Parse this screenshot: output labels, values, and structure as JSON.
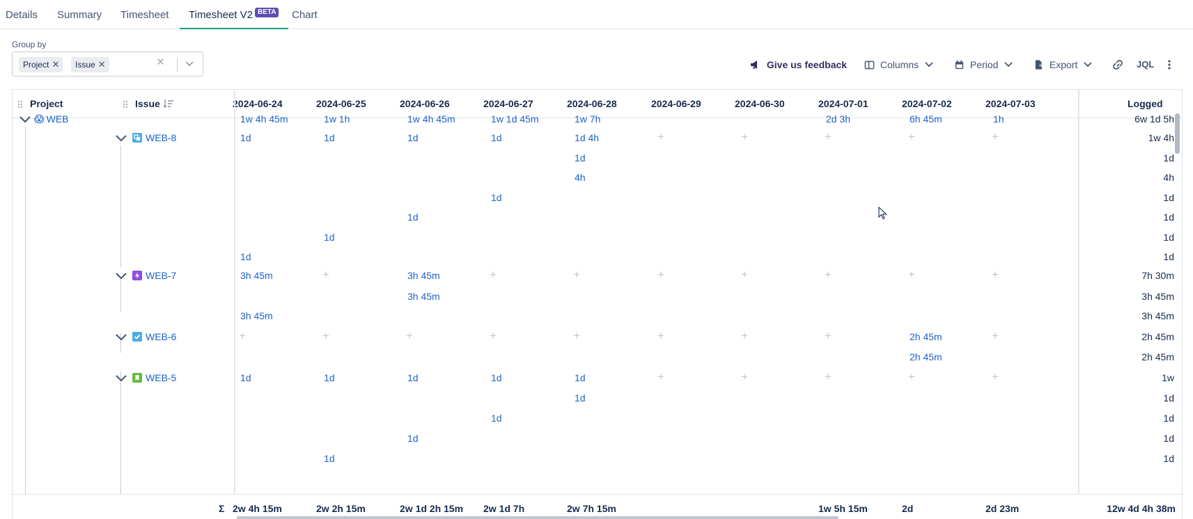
{
  "tabs": [
    {
      "label": "Details"
    },
    {
      "label": "Summary"
    },
    {
      "label": "Timesheet"
    },
    {
      "label": "Timesheet V2",
      "badge": "BETA",
      "active": true
    },
    {
      "label": "Chart"
    }
  ],
  "group_by": {
    "label": "Group by",
    "chips": [
      "Project",
      "Issue"
    ],
    "clear_glyph": "×"
  },
  "toolbar": {
    "feedback": "Give us feedback",
    "columns": "Columns",
    "period": "Period",
    "export": "Export",
    "jql": "JQL"
  },
  "grid": {
    "col_project": "Project",
    "col_issue": "Issue",
    "dates": [
      "2024-06-24",
      "2024-06-25",
      "2024-06-26",
      "2024-06-27",
      "2024-06-28",
      "2024-06-29",
      "2024-06-30",
      "2024-07-01",
      "2024-07-02",
      "2024-07-03"
    ],
    "col_logged": "Logged",
    "project": {
      "key": "WEB",
      "emoji": "😱"
    },
    "rows": [
      {
        "type": "project",
        "label": "WEB",
        "cells": [
          "1w 4h 45m",
          "1w 1h",
          "1w 4h 45m",
          "1w 1d 45m",
          "1w 7h",
          "",
          "",
          "2d 3h",
          "6h 45m",
          "1h"
        ],
        "logged": "6w 1d 5h"
      },
      {
        "type": "issue",
        "label": "WEB-8",
        "icon": "subtask-icon",
        "color": "#4bade8",
        "cells": [
          "1d",
          "1d",
          "1d",
          "1d",
          "1d 4h",
          "+",
          "+",
          "+",
          "+",
          "+"
        ],
        "logged": "1w 4h"
      },
      {
        "type": "entry",
        "cells": [
          "",
          "",
          "",
          "",
          "1d",
          "",
          "",
          "",
          "",
          ""
        ],
        "logged": "1d"
      },
      {
        "type": "entry",
        "cells": [
          "",
          "",
          "",
          "",
          "4h",
          "",
          "",
          "",
          "",
          ""
        ],
        "logged": "4h"
      },
      {
        "type": "entry",
        "cells": [
          "",
          "",
          "",
          "1d",
          "",
          "",
          "",
          "",
          "",
          ""
        ],
        "logged": "1d"
      },
      {
        "type": "entry",
        "cells": [
          "",
          "",
          "1d",
          "",
          "",
          "",
          "",
          "",
          "",
          ""
        ],
        "logged": "1d"
      },
      {
        "type": "entry",
        "cells": [
          "",
          "1d",
          "",
          "",
          "",
          "",
          "",
          "",
          "",
          ""
        ],
        "logged": "1d"
      },
      {
        "type": "entry",
        "cells": [
          "1d",
          "",
          "",
          "",
          "",
          "",
          "",
          "",
          "",
          ""
        ],
        "logged": "1d"
      },
      {
        "type": "issue",
        "label": "WEB-7",
        "icon": "epic-icon",
        "color": "#904ee2",
        "cells": [
          "3h 45m",
          "+",
          "3h 45m",
          "+",
          "+",
          "+",
          "+",
          "+",
          "+",
          "+"
        ],
        "logged": "7h 30m"
      },
      {
        "type": "entry",
        "cells": [
          "",
          "",
          "3h 45m",
          "",
          "",
          "",
          "",
          "",
          "",
          ""
        ],
        "logged": "3h 45m"
      },
      {
        "type": "entry",
        "cells": [
          "3h 45m",
          "",
          "",
          "",
          "",
          "",
          "",
          "",
          "",
          ""
        ],
        "logged": "3h 45m"
      },
      {
        "type": "issue",
        "label": "WEB-6",
        "icon": "task-icon",
        "color": "#4bade8",
        "cells": [
          "+",
          "+",
          "+",
          "+",
          "+",
          "+",
          "+",
          "+",
          "2h 45m",
          "+"
        ],
        "logged": "2h 45m"
      },
      {
        "type": "entry",
        "cells": [
          "",
          "",
          "",
          "",
          "",
          "",
          "",
          "",
          "2h 45m",
          ""
        ],
        "logged": "2h 45m"
      },
      {
        "type": "issue",
        "label": "WEB-5",
        "icon": "story-icon",
        "color": "#63ba3c",
        "cells": [
          "1d",
          "1d",
          "1d",
          "1d",
          "1d",
          "+",
          "+",
          "+",
          "+",
          "+"
        ],
        "logged": "1w"
      },
      {
        "type": "entry",
        "cells": [
          "",
          "",
          "",
          "",
          "1d",
          "",
          "",
          "",
          "",
          ""
        ],
        "logged": "1d"
      },
      {
        "type": "entry",
        "cells": [
          "",
          "",
          "",
          "1d",
          "",
          "",
          "",
          "",
          "",
          ""
        ],
        "logged": "1d"
      },
      {
        "type": "entry",
        "cells": [
          "",
          "",
          "1d",
          "",
          "",
          "",
          "",
          "",
          "",
          ""
        ],
        "logged": "1d"
      },
      {
        "type": "entry",
        "cells": [
          "",
          "1d",
          "",
          "",
          "",
          "",
          "",
          "",
          "",
          ""
        ],
        "logged": "1d"
      }
    ],
    "footer": {
      "sigma": "Σ",
      "totals": [
        "2w 4h 15m",
        "2w 2h 15m",
        "2w 1d 2h 15m",
        "2w 1d 7h",
        "2w 7h 15m",
        "",
        "",
        "1w 5h 15m",
        "2d",
        "2d 23m"
      ],
      "logged": "12w 4d 4h 38m"
    }
  }
}
